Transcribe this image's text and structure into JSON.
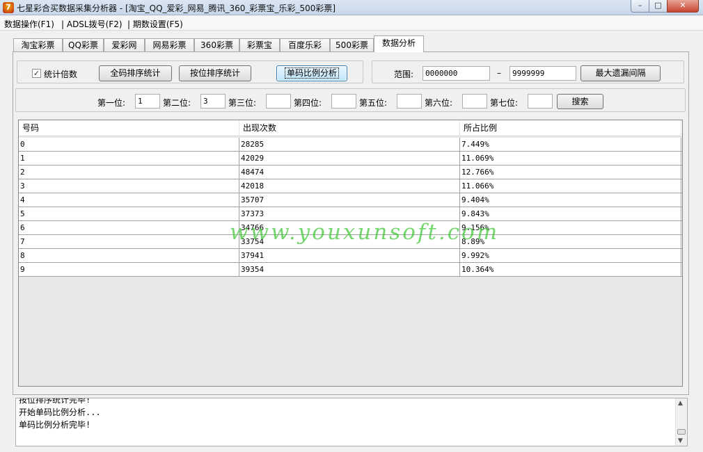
{
  "window": {
    "title": "七星彩合买数据采集分析器 - [淘宝_QQ_爱彩_网易_腾讯_360_彩票宝_乐彩_500彩票]",
    "app_icon_glyph": "7"
  },
  "menu": [
    "数据操作(F1)",
    "| ADSL拨号(F2)",
    "| 期数设置(F5)"
  ],
  "tabs": [
    {
      "label": "淘宝彩票",
      "active": false
    },
    {
      "label": "QQ彩票",
      "active": false
    },
    {
      "label": "爱彩网",
      "active": false
    },
    {
      "label": "网易彩票",
      "active": false
    },
    {
      "label": "360彩票",
      "active": false
    },
    {
      "label": "彩票宝",
      "active": false
    },
    {
      "label": "百度乐彩",
      "active": false
    },
    {
      "label": "500彩票",
      "active": false
    },
    {
      "label": "数据分析",
      "active": true
    }
  ],
  "toolbar": {
    "multiplier_label": "统计倍数",
    "multiplier_checked": true,
    "full_sort_button": "全码排序统计",
    "position_sort_button": "按位排序统计",
    "single_ratio_button": "单码比例分析",
    "range_label": "范围:",
    "range_from": "0000000",
    "range_sep": "–",
    "range_to": "9999999",
    "max_gap_button": "最大遗漏间隔"
  },
  "positions": {
    "labels": [
      "第一位:",
      "第二位:",
      "第三位:",
      "第四位:",
      "第五位:",
      "第六位:",
      "第七位:"
    ],
    "values": [
      "1",
      "3",
      "",
      "",
      "",
      "",
      ""
    ],
    "search_button": "搜索"
  },
  "table": {
    "headers": [
      "号码",
      "出现次数",
      "所占比例"
    ],
    "rows": [
      [
        "0",
        "28285",
        "7.449%"
      ],
      [
        "1",
        "42029",
        "11.069%"
      ],
      [
        "2",
        "48474",
        "12.766%"
      ],
      [
        "3",
        "42018",
        "11.066%"
      ],
      [
        "4",
        "35707",
        "9.404%"
      ],
      [
        "5",
        "37373",
        "9.843%"
      ],
      [
        "6",
        "34766",
        "9.156%"
      ],
      [
        "7",
        "33754",
        "8.89%"
      ],
      [
        "8",
        "37941",
        "9.992%"
      ],
      [
        "9",
        "39354",
        "10.364%"
      ]
    ]
  },
  "watermark": "www.youxunsoft.com",
  "log": [
    "按位排序统计完毕!",
    "开始单码比例分析...",
    "单码比例分析完毕!"
  ]
}
